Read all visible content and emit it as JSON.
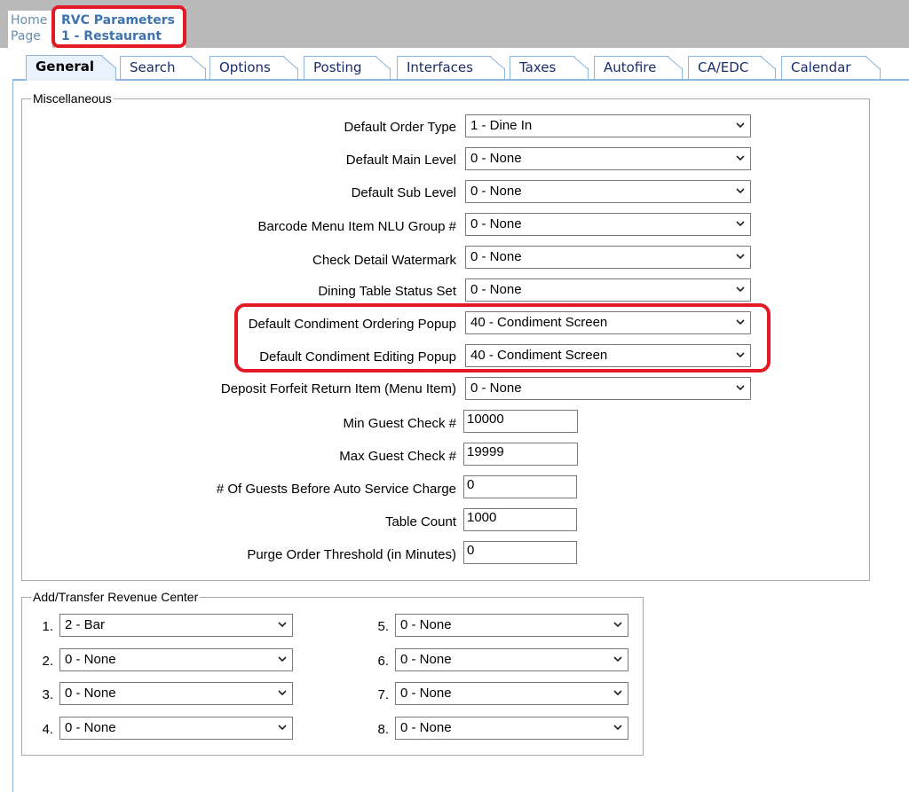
{
  "header": {
    "home_line1": "Home",
    "home_line2": "Page",
    "rvc_line1": "RVC Parameters",
    "rvc_line2": "1 - Restaurant"
  },
  "tabs": [
    {
      "label": "General",
      "active": true
    },
    {
      "label": "Search"
    },
    {
      "label": "Options"
    },
    {
      "label": "Posting"
    },
    {
      "label": "Interfaces"
    },
    {
      "label": "Taxes"
    },
    {
      "label": "Autofire"
    },
    {
      "label": "CA/EDC"
    },
    {
      "label": "Calendar"
    }
  ],
  "misc": {
    "legend": "Miscellaneous",
    "fields": [
      {
        "label": "Default Order Type",
        "value": "1 - Dine In"
      },
      {
        "label": "Default Main Level",
        "value": "0 - None"
      },
      {
        "label": "Default Sub Level",
        "value": "0 - None"
      },
      {
        "label": "Barcode Menu Item NLU Group #",
        "value": "0 - None"
      },
      {
        "label": "Check Detail Watermark",
        "value": "0 - None"
      },
      {
        "label": "Dining Table Status Set",
        "value": "0 - None"
      },
      {
        "label": "Default Condiment Ordering Popup",
        "value": "40 - Condiment Screen"
      },
      {
        "label": "Default Condiment Editing Popup",
        "value": "40 - Condiment Screen"
      },
      {
        "label": "Deposit Forfeit Return Item (Menu Item)",
        "value": "0 - None"
      },
      {
        "label": "Min Guest Check #",
        "value": "10000"
      },
      {
        "label": "Max Guest Check #",
        "value": "19999"
      },
      {
        "label": "# Of Guests Before Auto Service Charge",
        "value": "0"
      },
      {
        "label": "Table Count",
        "value": "1000"
      },
      {
        "label": "Purge Order Threshold (in Minutes)",
        "value": "0"
      }
    ]
  },
  "add_transfer": {
    "legend": "Add/Transfer Revenue Center",
    "items": [
      {
        "num": "1.",
        "value": "2 - Bar"
      },
      {
        "num": "2.",
        "value": "0 - None"
      },
      {
        "num": "3.",
        "value": "0 - None"
      },
      {
        "num": "4.",
        "value": "0 - None"
      },
      {
        "num": "5.",
        "value": "0 - None"
      },
      {
        "num": "6.",
        "value": "0 - None"
      },
      {
        "num": "7.",
        "value": "0 - None"
      },
      {
        "num": "8.",
        "value": "0 - None"
      }
    ]
  },
  "colors": {
    "highlight": "#e31a25",
    "tab_border": "#8fb6de",
    "link": "#3d74b0"
  }
}
